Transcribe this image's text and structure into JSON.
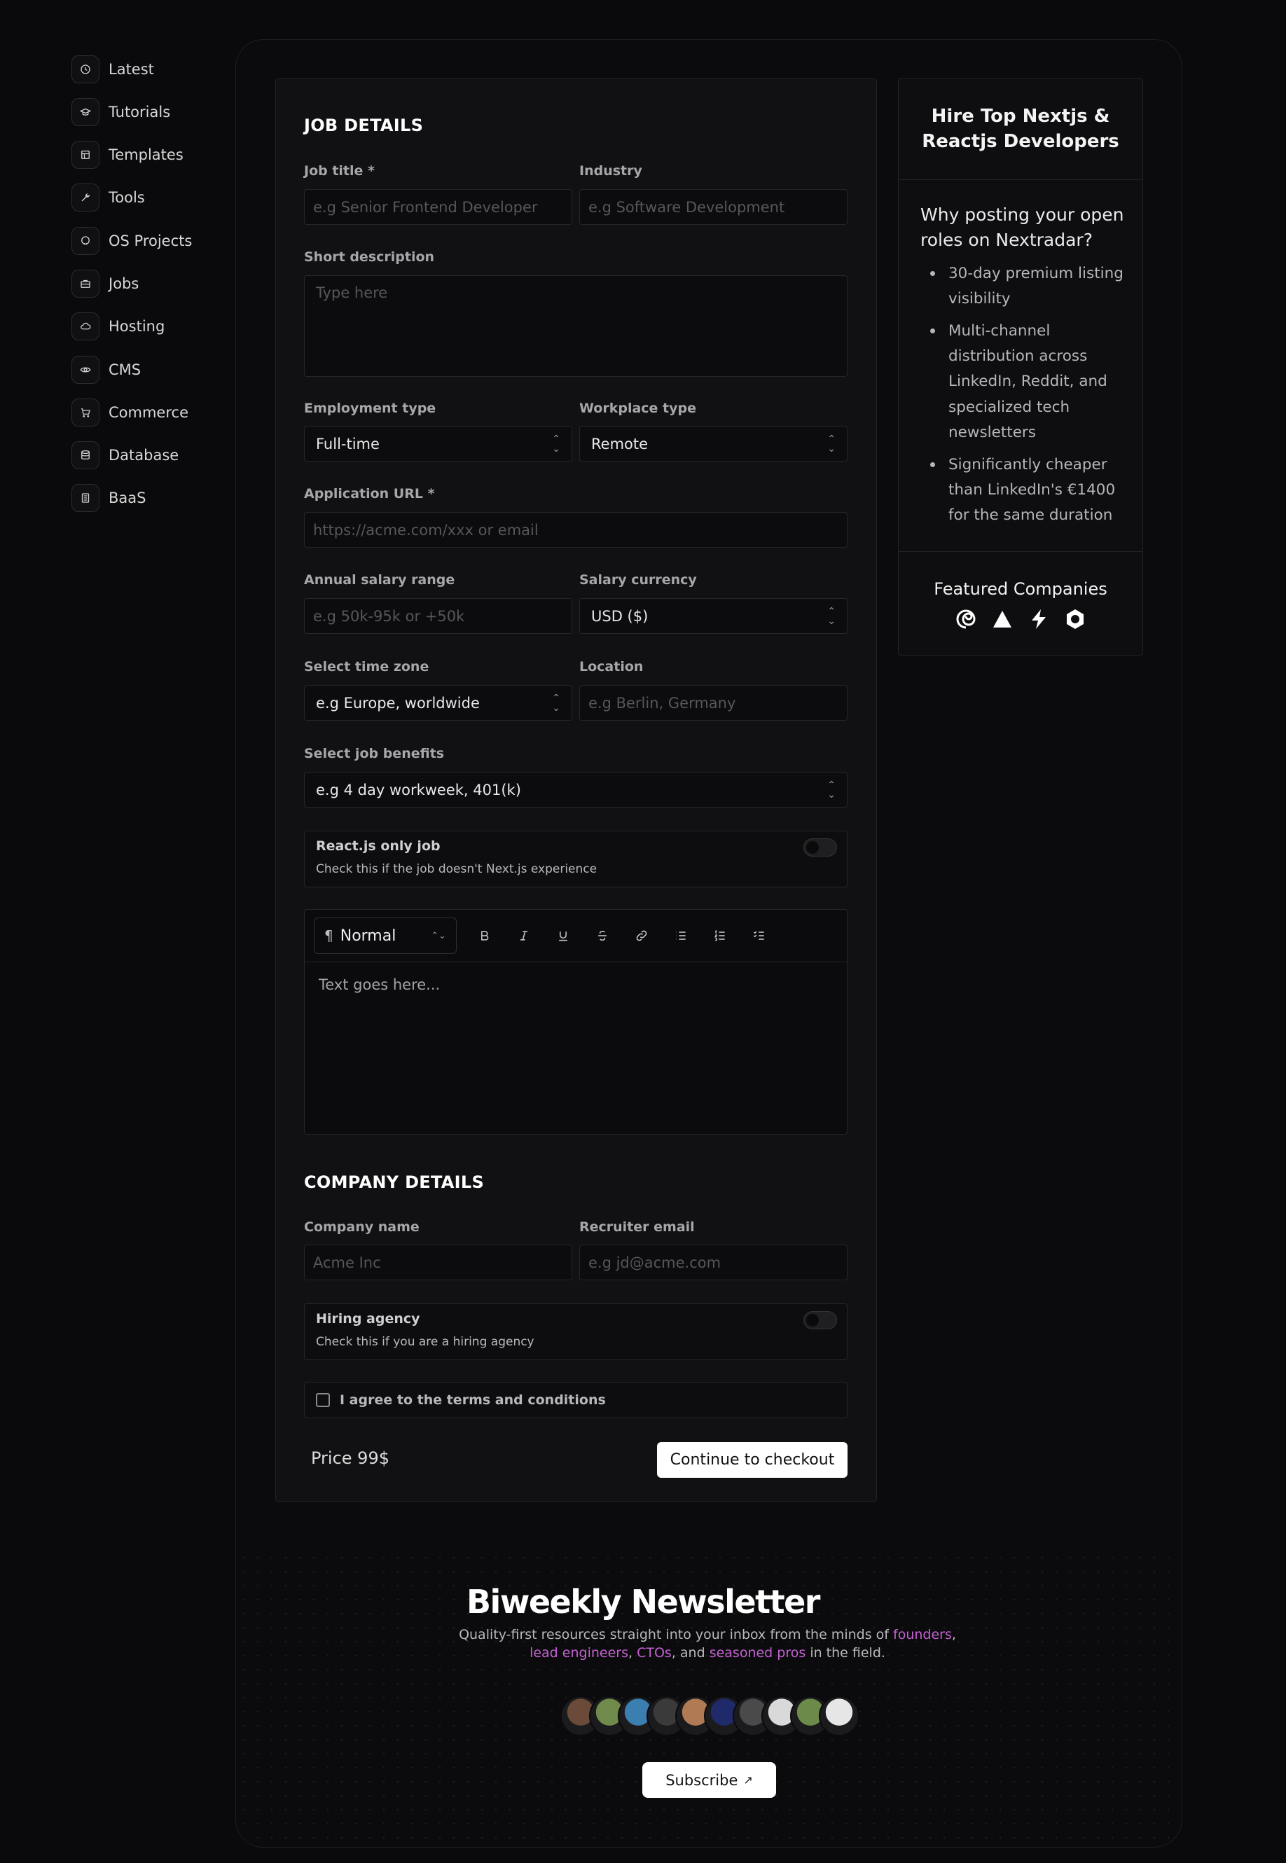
{
  "sidebar": {
    "items": [
      {
        "label": "Latest",
        "icon": "clock-icon"
      },
      {
        "label": "Tutorials",
        "icon": "graduation-cap-icon"
      },
      {
        "label": "Templates",
        "icon": "layout-icon"
      },
      {
        "label": "Tools",
        "icon": "wrench-icon"
      },
      {
        "label": "OS Projects",
        "icon": "github-icon"
      },
      {
        "label": "Jobs",
        "icon": "briefcase-icon"
      },
      {
        "label": "Hosting",
        "icon": "cloud-icon"
      },
      {
        "label": "CMS",
        "icon": "eye-icon"
      },
      {
        "label": "Commerce",
        "icon": "cart-icon"
      },
      {
        "label": "Database",
        "icon": "database-icon"
      },
      {
        "label": "BaaS",
        "icon": "server-icon"
      }
    ]
  },
  "job": {
    "section_title": "JOB DETAILS",
    "job_title_label": "Job title *",
    "job_title_placeholder": "e.g Senior Frontend Developer",
    "industry_label": "Industry",
    "industry_placeholder": "e.g Software Development",
    "short_desc_label": "Short description",
    "short_desc_placeholder": "Type here",
    "employment_label": "Employment type",
    "employment_value": "Full-time",
    "workplace_label": "Workplace type",
    "workplace_value": "Remote",
    "app_url_label": "Application URL *",
    "app_url_placeholder": "https://acme.com/xxx or email",
    "salary_label": "Annual salary range",
    "salary_placeholder": "e.g 50k-95k or +50k",
    "currency_label": "Salary currency",
    "currency_value": "USD ($)",
    "timezone_label": "Select time zone",
    "timezone_value": "e.g Europe, worldwide",
    "location_label": "Location",
    "location_placeholder": "e.g Berlin, Germany",
    "benefits_label": "Select job benefits",
    "benefits_value": "e.g 4 day workweek, 401(k)",
    "react_toggle_title": "React.js only job",
    "react_toggle_sub": "Check this if the job doesn't Next.js experience",
    "editor_style": "Normal",
    "editor_placeholder": "Text goes here..."
  },
  "company": {
    "section_title": "COMPANY DETAILS",
    "name_label": "Company name",
    "name_placeholder": "Acme Inc",
    "email_label": "Recruiter email",
    "email_placeholder": "e.g jd@acme.com",
    "agency_title": "Hiring agency",
    "agency_sub": "Check this if you are a hiring agency",
    "terms_label": "I agree to the terms and conditions",
    "price": "Price 99$",
    "checkout_label": "Continue to checkout"
  },
  "side": {
    "heading": "Hire Top Nextjs & Reactjs Developers",
    "why_title": "Why posting your open roles on Nextradar?",
    "bullets": [
      "30-day premium listing visibility",
      "Multi-channel distribution across LinkedIn, Reddit, and specialized tech newsletters",
      "Significantly cheaper than LinkedIn's €1400 for the same duration"
    ],
    "featured_title": "Featured Companies",
    "logos": [
      "spiral-logo-icon",
      "triangle-logo-icon",
      "bolt-logo-icon",
      "hexagon-logo-icon"
    ]
  },
  "newsletter": {
    "title": "Biweekly Newsletter",
    "sub_prefix": "Quality-first resources straight into your inbox from the minds of",
    "hl1": "founders",
    "sep1": ",",
    "hl2": "lead engineers",
    "sep2": ",",
    "hl3": "CTOs",
    "sep3": ", and",
    "hl4": "seasoned pros",
    "sub_suffix": "in the field.",
    "subscribe_label": "Subscribe",
    "avatar_colors": [
      "#6b4a3a",
      "#6f8a4a",
      "#3b7fb0",
      "#3a3a3a",
      "#b07a55",
      "#1f2a6b",
      "#4a4a4a",
      "#d9d9d9",
      "#6c8a4a",
      "#e6e6e6"
    ],
    "highlight_color": "#c461d1"
  },
  "colors": {
    "background": "#0a0a0c",
    "card": "#111113",
    "button": "#ffffff"
  }
}
